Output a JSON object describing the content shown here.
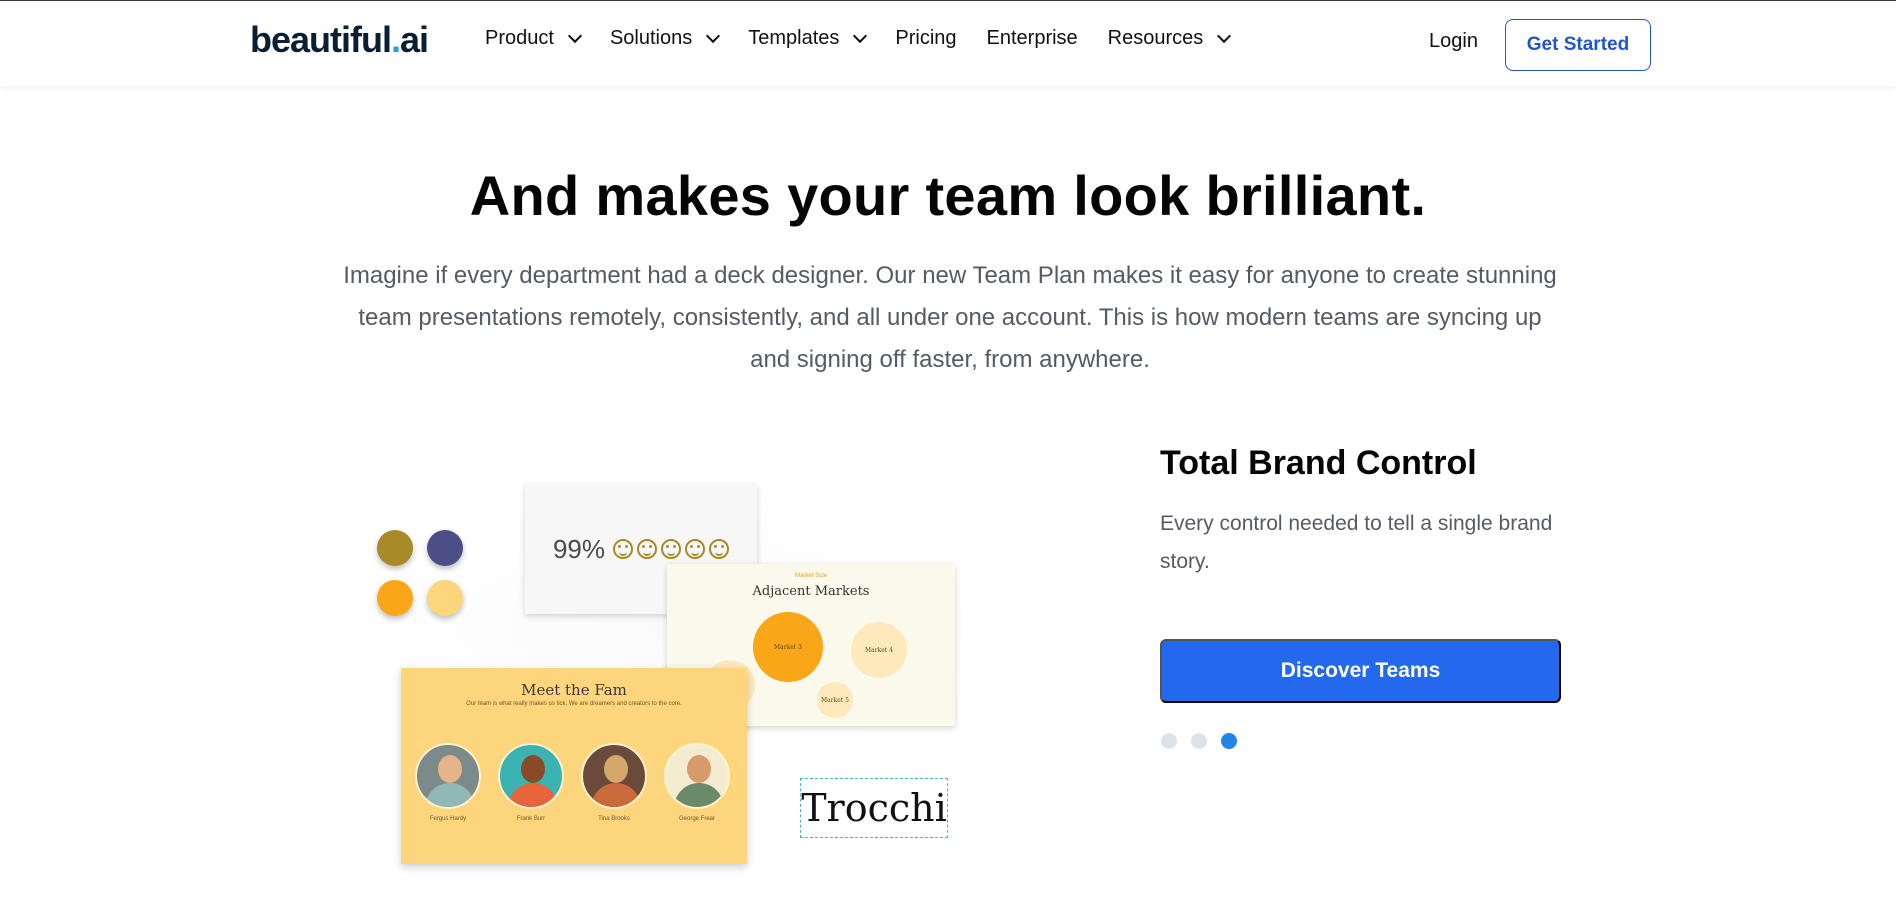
{
  "header": {
    "logo_main": "beautiful",
    "logo_dot": ".",
    "logo_tail": "ai",
    "nav": [
      {
        "label": "Product",
        "has_dropdown": true
      },
      {
        "label": "Solutions",
        "has_dropdown": true
      },
      {
        "label": "Templates",
        "has_dropdown": true
      },
      {
        "label": "Pricing",
        "has_dropdown": false
      },
      {
        "label": "Enterprise",
        "has_dropdown": false
      },
      {
        "label": "Resources",
        "has_dropdown": true
      }
    ],
    "login_label": "Login",
    "cta_label": "Get Started"
  },
  "hero": {
    "headline": "And makes your team look brilliant.",
    "subtext": "Imagine if every department had a deck designer. Our new Team Plan makes it easy for anyone to create stunning team presentations remotely, consistently, and all under one account. This is how modern teams are syncing up and signing off faster, from anywhere."
  },
  "illustration": {
    "swatches": [
      "#a88a28",
      "#4b4f86",
      "#f9a718",
      "#fcd57c"
    ],
    "stat_card": {
      "value": "99%",
      "icon": "smiley-face-icon",
      "icon_count": 5
    },
    "markets_card": {
      "kicker": "Market Size",
      "title": "Adjacent Markets",
      "bubbles": [
        "Market 3",
        "Market 4",
        "Market 5"
      ]
    },
    "team_card": {
      "title": "Meet the Fam",
      "subtitle": "Our team is what really makes us tick. We are dreamers and creators to the core.",
      "members": [
        "Fergus Hardy",
        "Frank Burr",
        "Tina Brooks",
        "George Frear"
      ]
    },
    "font_sample": "Trocchi"
  },
  "feature": {
    "title": "Total Brand Control",
    "description": "Every control needed to tell a single brand story.",
    "button_label": "Discover Teams",
    "carousel": {
      "count": 3,
      "active_index": 2
    }
  },
  "colors": {
    "accent": "#2468ee",
    "active_dot": "#1f86e8",
    "inactive_dot": "#dde3ea",
    "outline_button": "#2356c4"
  }
}
